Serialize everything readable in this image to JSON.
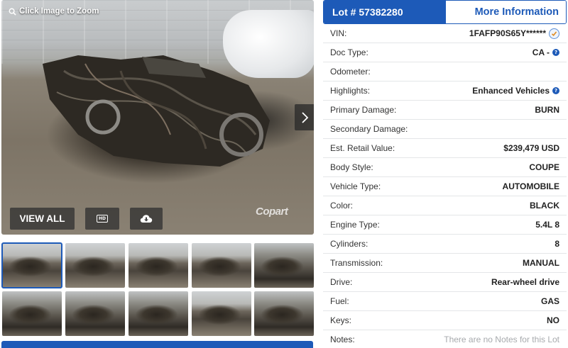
{
  "gallery": {
    "zoom_hint": "Click Image to Zoom",
    "view_all_label": "VIEW ALL",
    "hd_label": "HD",
    "watermark": "Copart",
    "thumbnail_count": 10,
    "selected_thumbnail": 1
  },
  "details": {
    "lot_label": "Lot # 57382280",
    "more_info_label": "More Information",
    "rows": [
      {
        "label": "VIN:",
        "value": "1FAFP90S65Y******"
      },
      {
        "label": "Doc Type:",
        "value": "CA -"
      },
      {
        "label": "Odometer:",
        "value": ""
      },
      {
        "label": "Highlights:",
        "value": "Enhanced Vehicles"
      },
      {
        "label": "Primary Damage:",
        "value": "BURN"
      },
      {
        "label": "Secondary Damage:",
        "value": ""
      },
      {
        "label": "Est. Retail Value:",
        "value": "$239,479 USD"
      },
      {
        "label": "Body Style:",
        "value": "COUPE"
      },
      {
        "label": "Vehicle Type:",
        "value": "AUTOMOBILE"
      },
      {
        "label": "Color:",
        "value": "BLACK"
      },
      {
        "label": "Engine Type:",
        "value": "5.4L 8"
      },
      {
        "label": "Cylinders:",
        "value": "8"
      },
      {
        "label": "Transmission:",
        "value": "MANUAL"
      },
      {
        "label": "Drive:",
        "value": "Rear-wheel drive"
      },
      {
        "label": "Fuel:",
        "value": "GAS"
      },
      {
        "label": "Keys:",
        "value": "NO"
      },
      {
        "label": "Notes:",
        "value": "There are no Notes for this Lot"
      }
    ]
  },
  "colors": {
    "accent": "#1d5ab8",
    "muted": "#a7aaad"
  },
  "icons": [
    "search-icon",
    "chevron-right-icon",
    "hd-icon",
    "cloud-download-icon",
    "help-icon",
    "verified-check-icon"
  ]
}
